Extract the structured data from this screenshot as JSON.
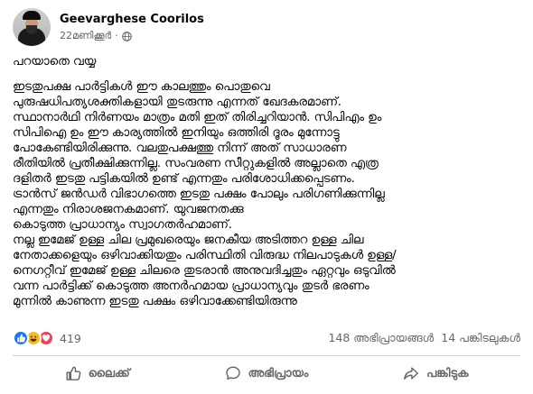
{
  "post": {
    "author": "Geevarghese Coorilos",
    "time": "22മണിക്കൂർ",
    "separator": "·",
    "avatar_icon": "profile-photo",
    "privacy_icon": "globe-icon",
    "title": "പറയാതെ വയ്യ",
    "lines": [
      "ഇടതുപക്ഷ പാർട്ടികൾ ഈ കാലത്തും പൊതുവെ",
      "പുരുഷധിപത്യശക്തികളായി തുടരുന്നു എന്നത് ഖേദകരമാണ്.",
      "സ്ഥാനാർഥി നിർണയം മാത്രം മതി ഇത് തിരിച്ചറിയാൻ. സിപിഎം ഉം",
      "സിപിഐ ഉം ഈ കാര്യത്തിൽ ഇനിയും ഒത്തിരി ദൂരം മുന്നോട്ടു",
      "പോകേണ്ടിയിരിക്കുന്നു. വലതുപക്ഷത്തു നിന്ന് അത് സാധാരണ",
      "രീതിയിൽ പ്രതീക്ഷിക്കുന്നില്ല. സംവരണ സീറ്റുകളിൽ അല്ലാതെ എത്ര",
      "ദളിതർ ഇടതു പട്ടികയിൽ ഉണ്ട് എന്നതും പരിശോധിക്കപ്പെടണം.",
      "ട്രാൻസ് ജൻഡർ വിഭാഗത്തെ ഇടതു പക്ഷം പോലും പരിഗണിക്കുന്നില്ല",
      "എന്നതും നിരാശജനകമാണ്. യുവജനതക്കു",
      "കൊടുത്ത പ്രാധാന്യം സ്വാഗതർഹമാണ്.",
      "നല്ല ഇമേജ് ഉള്ള ചില പ്രമുഖരെയും ജനകീയ അടിത്തറ ഉള്ള ചില",
      "നേതാക്കളെയും ഒഴിവാക്കിയതും പരിസ്ഥിതി വിരുദ്ധ നിലപാടുകൾ ഉള്ള/",
      "നെഗറ്റീവ് ഇമേജ് ഉള്ള ചിലരെ തുടരാൻ അനുവദിച്ചതും ഏറ്റവും ഒടുവിൽ",
      "വന്ന പാർട്ടിക്ക് കൊടുത്ത അനർഹമായ പ്രാധാന്യവും തുടർ ഭരണം",
      "മുന്നിൽ കാണുന്ന ഇടതു പക്ഷം ഒഴിവാക്കേണ്ടിയിരുന്നു"
    ]
  },
  "reactions": {
    "icons": [
      "like-reaction",
      "haha-reaction",
      "love-reaction"
    ],
    "count": "419",
    "comments": "148 അഭിപ്രായങ്ങൾ",
    "shares": "14 പങ്കിടലുകൾ"
  },
  "actions": {
    "like": "ലൈക്ക്",
    "comment": "അഭിപ്രായം",
    "share": "പങ്കിടുക"
  },
  "colors": {
    "like_blue": "#1877f2",
    "haha_yellow": "#f7b928",
    "love_red": "#f33e58",
    "muted_text": "#65676b"
  }
}
